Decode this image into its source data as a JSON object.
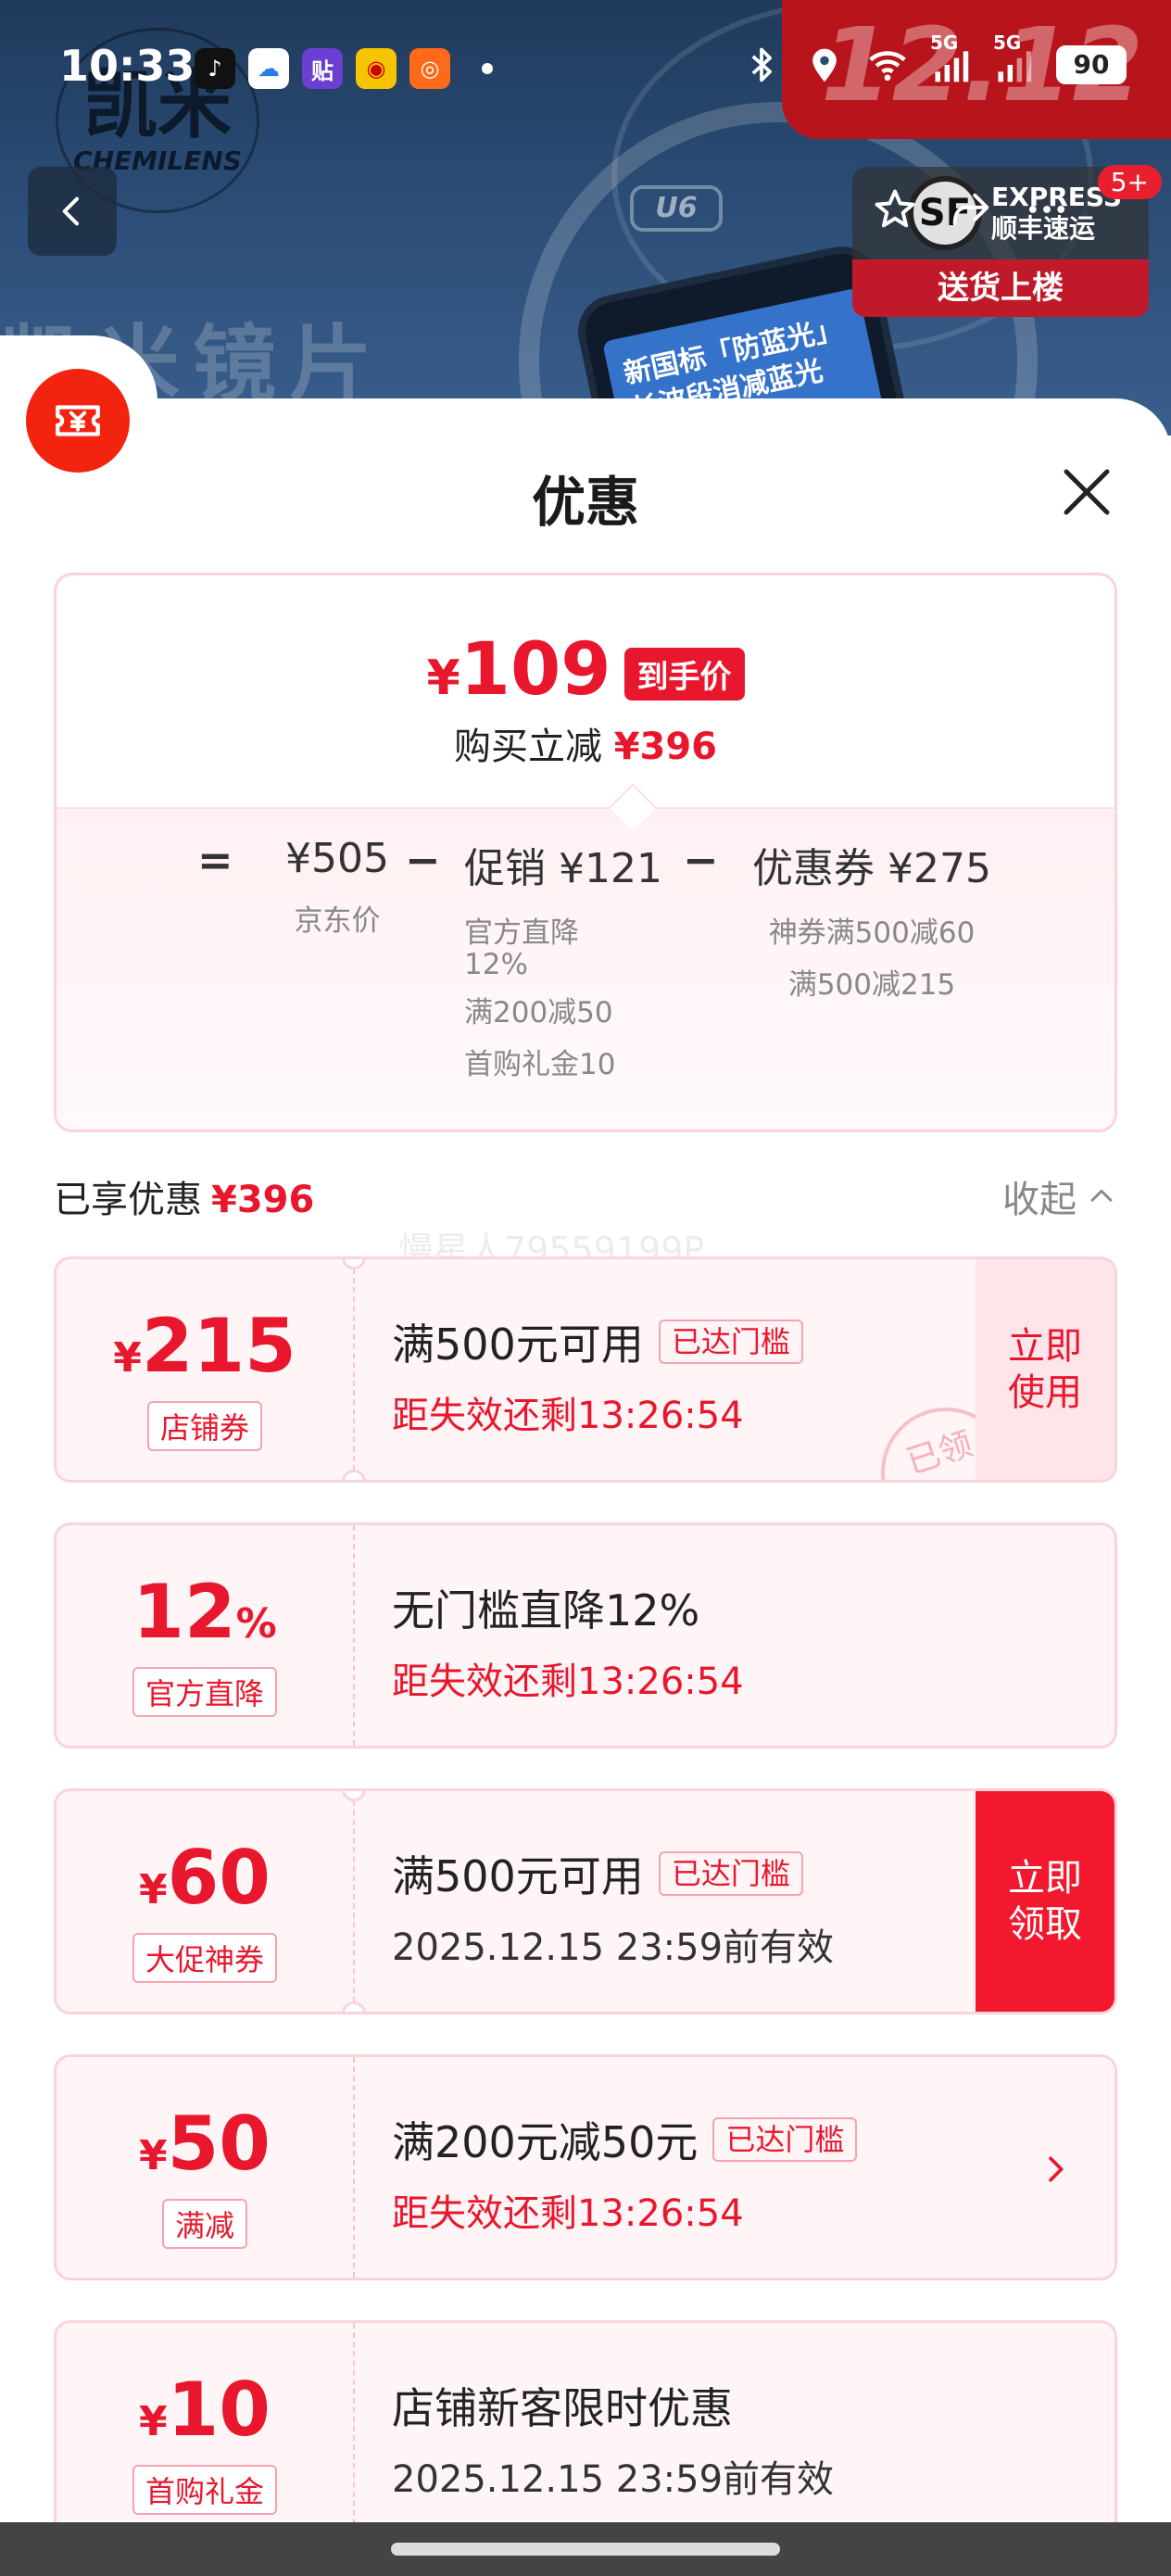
{
  "status_bar": {
    "time": "10:33",
    "network_1": "5G",
    "network_2": "5G",
    "battery": "90"
  },
  "banner": {
    "brand_big": "凯米",
    "brand_small": "CHEMILENS",
    "title": "凯米镜片",
    "lens_model": "U6",
    "phone_text_1": "新国标「防蓝光」",
    "phone_text_2": "长波段消减蓝光",
    "promo_1212": "12.12",
    "express_line_1": "EXPRESS",
    "express_line_2": "顺丰速运",
    "express_bottom": "送货上楼",
    "badge_count": "5+"
  },
  "sheet": {
    "title": "优惠"
  },
  "price_summary": {
    "currency": "¥",
    "final_price": "109",
    "final_tag": "到手价",
    "saved_label": "购买立减",
    "saved_amount": "¥396",
    "equals": "=",
    "minus": "−",
    "jd_price": "¥505",
    "jd_label": "京东价",
    "promo_total": "促销 ¥121",
    "promo_items": [
      "官方直降",
      "12%",
      "满200减50",
      "首购礼金10"
    ],
    "coupon_total": "优惠券 ¥275",
    "coupon_items": [
      "神券满500减60",
      "满500减215"
    ]
  },
  "enjoyed": {
    "label": "已享优惠",
    "amount": "¥396",
    "collapse_label": "收起"
  },
  "watermark": "慢星人79559199P",
  "coupons": [
    {
      "currency": "¥",
      "value": "215",
      "type": "店铺券",
      "title": "满500元可用",
      "tag": "已达门槛",
      "sub": "距失效还剩13:26:54",
      "action": "立即使用",
      "stamp": "已领"
    },
    {
      "value": "12",
      "unit": "%",
      "type": "官方直降",
      "title": "无门槛直降12%",
      "sub": "距失效还剩13:26:54"
    },
    {
      "currency": "¥",
      "value": "60",
      "type": "大促神券",
      "title": "满500元可用",
      "tag": "已达门槛",
      "sub": "2025.12.15 23:59前有效",
      "action": "立即领取"
    },
    {
      "currency": "¥",
      "value": "50",
      "type": "满减",
      "title": "满200元减50元",
      "tag": "已达门槛",
      "sub": "距失效还剩13:26:54"
    },
    {
      "currency": "¥",
      "value": "10",
      "type": "首购礼金",
      "title": "店铺新客限时优惠",
      "sub": "2025.12.15 23:59前有效"
    }
  ],
  "colors": {
    "accent_red": "#e8172d",
    "action_red": "#f2182e",
    "card_bg": "#fff5f6",
    "card_border": "#fbd3da"
  }
}
